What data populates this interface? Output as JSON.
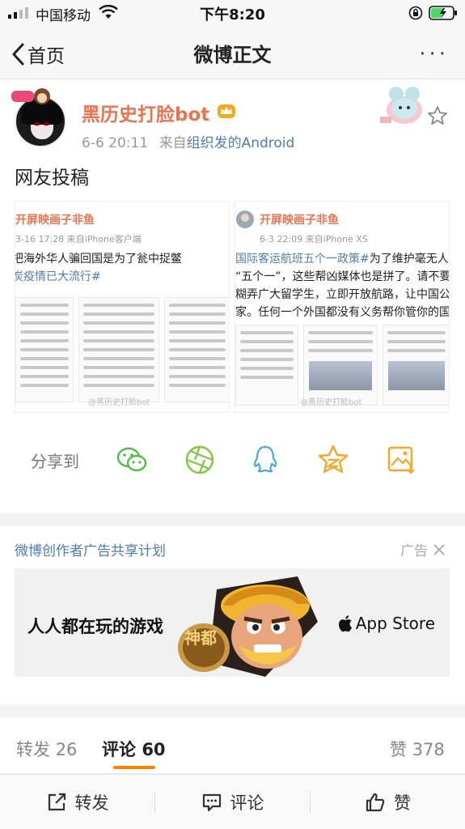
{
  "status_bar": {
    "carrier": "中国移动",
    "time": "下午8:20"
  },
  "nav": {
    "back_label": "首页",
    "title": "微博正文",
    "more_label": "···"
  },
  "post": {
    "username": "黑历史打脸bot",
    "timestamp": "6-6 20:11",
    "source_prefix": "来自",
    "source": "组织发的Android",
    "text": "网友投稿",
    "images": [
      {
        "username": "开屏映画子非鱼",
        "meta": "3-16 17:28  来自iPhone客户端",
        "line1": "把海外华人骗回国是为了瓮中捉鳖",
        "line2": "炭疫情已大流行#",
        "watermark": "@黑历史打脸bot"
      },
      {
        "username": "开屏映画子非鱼",
        "meta": "6-3 22:09  来自iPhone XS",
        "line1_blue": "国际客运航班五个一政策#",
        "line1": "为了维护毫无人道",
        "line2": "“五个一”，这些帮凶媒体也是拼了。请不要绑",
        "line3": "糊弄广大留学生，立即开放航路，让中国公民",
        "line4": "家。任何一个外国都没有义务帮你管你的国",
        "watermark": "@黑历史打脸bot"
      }
    ]
  },
  "share": {
    "label": "分享到",
    "targets": [
      "wechat-icon",
      "moments-icon",
      "qq-icon",
      "qzone-icon",
      "save-image-icon"
    ]
  },
  "ad": {
    "title": "微博创作者广告共享计划",
    "tag": "广告",
    "slogan": "人人都在玩的游戏",
    "store": "App Store",
    "game_badge": "神都"
  },
  "tabs": [
    {
      "label": "转发",
      "count": "26"
    },
    {
      "label": "评论",
      "count": "60"
    },
    {
      "label": "赞",
      "count": "378"
    }
  ],
  "actions": {
    "repost": "转发",
    "comment": "评论",
    "like": "赞"
  },
  "colors": {
    "accent": "#ff8200",
    "username": "#eb7350",
    "link": "#507daf"
  }
}
